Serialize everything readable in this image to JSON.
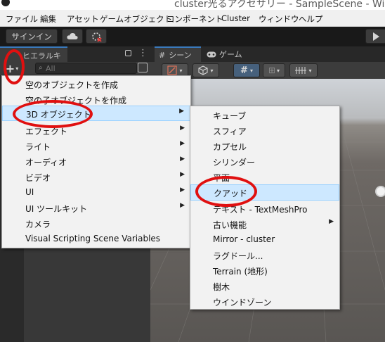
{
  "window": {
    "title": "cluster光るアクセサリー - SampleScene - Windows"
  },
  "menubar": [
    "ファイル",
    "編集",
    "アセット",
    "ゲームオブジェクト",
    "コンポーネント",
    "Cluster",
    "ウィンドウ",
    "ヘルプ"
  ],
  "toolbar": {
    "signin_label": "サインイン",
    "cloud_icon": "cloud-icon",
    "collab_icon": "collab-off-icon",
    "play_icon": "play-icon"
  },
  "hierarchy": {
    "tab_label": "ヒエラルキー",
    "add_label": "+",
    "search_placeholder": "All"
  },
  "scene": {
    "tabs": [
      {
        "label": "シーン",
        "icon": "hash-icon"
      },
      {
        "label": "ゲーム",
        "icon": "gamepad-icon"
      }
    ]
  },
  "create_menu": {
    "items": [
      {
        "label": "空のオブジェクトを作成",
        "has_submenu": false
      },
      {
        "label": "空の子オブジェクトを作成",
        "has_submenu": false
      },
      {
        "label": "3D オブジェクト",
        "has_submenu": true,
        "highlighted": true
      },
      {
        "label": "エフェクト",
        "has_submenu": true
      },
      {
        "label": "ライト",
        "has_submenu": true
      },
      {
        "label": "オーディオ",
        "has_submenu": true
      },
      {
        "label": "ビデオ",
        "has_submenu": true
      },
      {
        "label": "UI",
        "has_submenu": true
      },
      {
        "label": "UI ツールキット",
        "has_submenu": true
      },
      {
        "label": "カメラ",
        "has_submenu": false
      },
      {
        "label": "Visual Scripting Scene Variables",
        "has_submenu": false
      }
    ]
  },
  "object3d_submenu": {
    "items": [
      {
        "label": "キューブ",
        "has_submenu": false
      },
      {
        "label": "スフィア",
        "has_submenu": false
      },
      {
        "label": "カプセル",
        "has_submenu": false
      },
      {
        "label": "シリンダー",
        "has_submenu": false
      },
      {
        "label": "平面",
        "has_submenu": false
      },
      {
        "label": "クアッド",
        "has_submenu": false,
        "highlighted": true
      },
      {
        "label": "テキスト - TextMeshPro",
        "has_submenu": false
      },
      {
        "label": "古い機能",
        "has_submenu": true
      },
      {
        "label": "Mirror - cluster",
        "has_submenu": false
      },
      {
        "label": "ラグドール...",
        "has_submenu": false
      },
      {
        "label": "Terrain (地形)",
        "has_submenu": false
      },
      {
        "label": "樹木",
        "has_submenu": false
      },
      {
        "label": "ウインドゾーン",
        "has_submenu": false
      }
    ]
  },
  "annotation_color": "#e01010",
  "highlight_color": "#cde8ff"
}
